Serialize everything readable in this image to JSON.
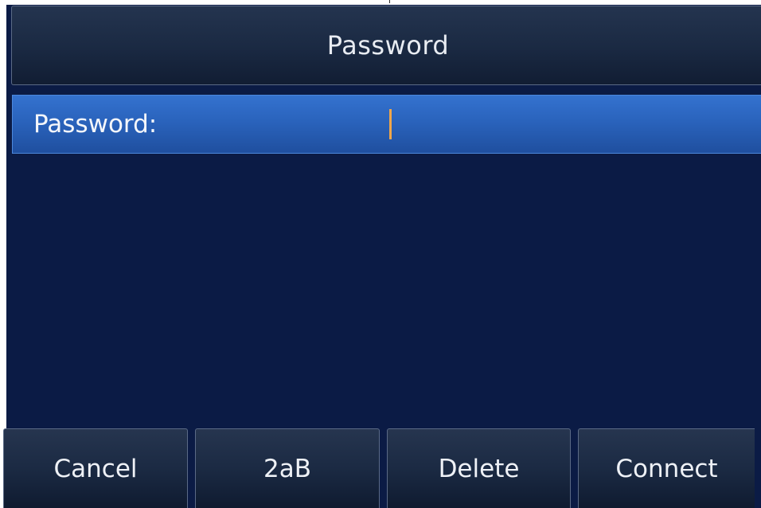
{
  "screen": {
    "title": "Password"
  },
  "form": {
    "password_label": "Password:",
    "password_value": ""
  },
  "softkeys": [
    {
      "label": "Cancel"
    },
    {
      "label": "2aB"
    },
    {
      "label": "Delete"
    },
    {
      "label": "Connect"
    }
  ],
  "colors": {
    "background": "#0b1b45",
    "selected_row": "#2a63bc",
    "cursor": "#f0a64a",
    "text": "#eef1f6"
  }
}
